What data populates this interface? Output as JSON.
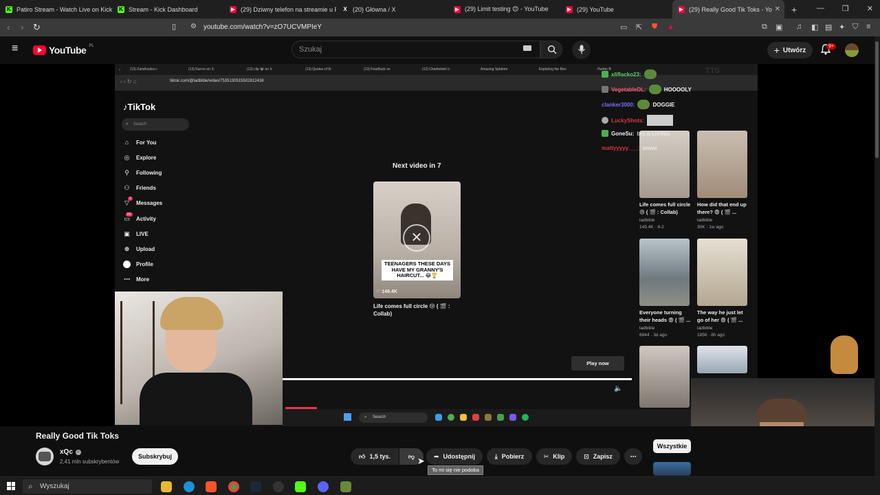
{
  "tabs": [
    {
      "label": "Patiro Stream - Watch Live on Kick",
      "icon": "kick-icon"
    },
    {
      "label": "Stream - Kick Dashboard",
      "icon": "kick-icon"
    },
    {
      "label": "(29) Dziwny telefon na streamie u Pa",
      "icon": "youtube-icon"
    },
    {
      "label": "(20) Główna / X",
      "icon": "x-icon"
    },
    {
      "label": "(29) Limit testing 😊 - YouTube",
      "icon": "youtube-icon"
    },
    {
      "label": "(29) YouTube",
      "icon": "youtube-icon"
    },
    {
      "label": "(29) Really Good Tik Toks - Yo",
      "icon": "youtube-icon",
      "active": true
    }
  ],
  "browser": {
    "url": "youtube.com/watch?v=zO7UCVMPIeY"
  },
  "youtube": {
    "logo_text": "YouTube",
    "region": "PL",
    "search_placeholder": "Szukaj",
    "create_label": "Utwórz",
    "notifications_badge": "9+"
  },
  "stream": {
    "inner_tabs": [
      "(13) Zarathustra c",
      "(13) Kurrco on X:",
      "(13) clip 😂 on X",
      "(13) Quotes of th",
      "(13) FearBuck on",
      "(12) CharlieIntel o",
      "Amazing Spiderm",
      "Exploring the Ben",
      "Hunter B"
    ],
    "inner_url": "tiktok.com/@ladbible/video/7535130515502812438",
    "tiktok_logo": "TikTok",
    "tiktok_search": "Search",
    "tiktok_nav": [
      {
        "label": "For You",
        "icon": "home-icon"
      },
      {
        "label": "Explore",
        "icon": "compass-icon"
      },
      {
        "label": "Following",
        "icon": "following-icon"
      },
      {
        "label": "Friends",
        "icon": "friends-icon"
      },
      {
        "label": "Messages",
        "icon": "messages-icon",
        "badge": "2"
      },
      {
        "label": "Activity",
        "icon": "activity-icon",
        "badge": "83"
      },
      {
        "label": "LIVE",
        "icon": "live-icon"
      },
      {
        "label": "Upload",
        "icon": "upload-icon"
      },
      {
        "label": "Profile",
        "icon": "profile-icon"
      },
      {
        "label": "More",
        "icon": "more-icon"
      }
    ],
    "next_video": "Next video in 7",
    "thumb_caption": "TEENAGERS THESE DAYS HAVE MY GRANNY'S HAIRCUT... 😂🏆",
    "thumb_likes": "149.4K",
    "thumb_title": "Life comes full circle 😢 ( 🎬 : Collab)",
    "play_now": "Play now",
    "taskbar_search": "Search",
    "side_videos": [
      {
        "title": "Life comes full circle 😢 ( 🎬 : Collab)",
        "channel": "ladbible",
        "meta": "149.4K · 8-2"
      },
      {
        "title": "How did that end up there? 😨 ( 🎬 ...",
        "channel": "ladbible",
        "meta": "30K · 1w ago"
      },
      {
        "title": "Everyone turning their heads 😨 ( 🎬 ...",
        "channel": "ladbible",
        "meta": "6844 · 3d ago"
      },
      {
        "title": "The way he just let go of her 😨 ( 🎬 ...",
        "channel": "ladbible",
        "meta": "1856 · 8h ago"
      }
    ],
    "chat": [
      {
        "user": "xliflacko23:",
        "msg": "",
        "color": "#58d26a"
      },
      {
        "user": "VegetableDL:",
        "msg": "HOOOOLY",
        "color": "#ff5c7a"
      },
      {
        "user": "clanker3000:",
        "msg": "DOGGIE",
        "color": "#7a6cff"
      },
      {
        "user": "LuckyShots:",
        "msg": "",
        "color": "#d93838"
      },
      {
        "user": "GoneSu:",
        "msg": "bro is LIVING",
        "color": "#f1f1f1"
      },
      {
        "user": "mattyyyyy___:",
        "msg": "awww",
        "color": "#d93838"
      }
    ],
    "top_right_label": "TTS"
  },
  "video": {
    "title": "Really Good Tik Toks",
    "channel": "xQc",
    "subscribers": "2,41 mln subskrybentów",
    "subscribe_label": "Subskrybuj",
    "likes": "1,5 tys.",
    "dislike_tooltip": "To mi się nie podoba",
    "share_label": "Udostępnij",
    "download_label": "Pobierz",
    "clip_label": "Klip",
    "save_label": "Zapisz",
    "filter_chip": "Wszystkie"
  },
  "taskbar": {
    "search_label": "Wyszukaj"
  }
}
